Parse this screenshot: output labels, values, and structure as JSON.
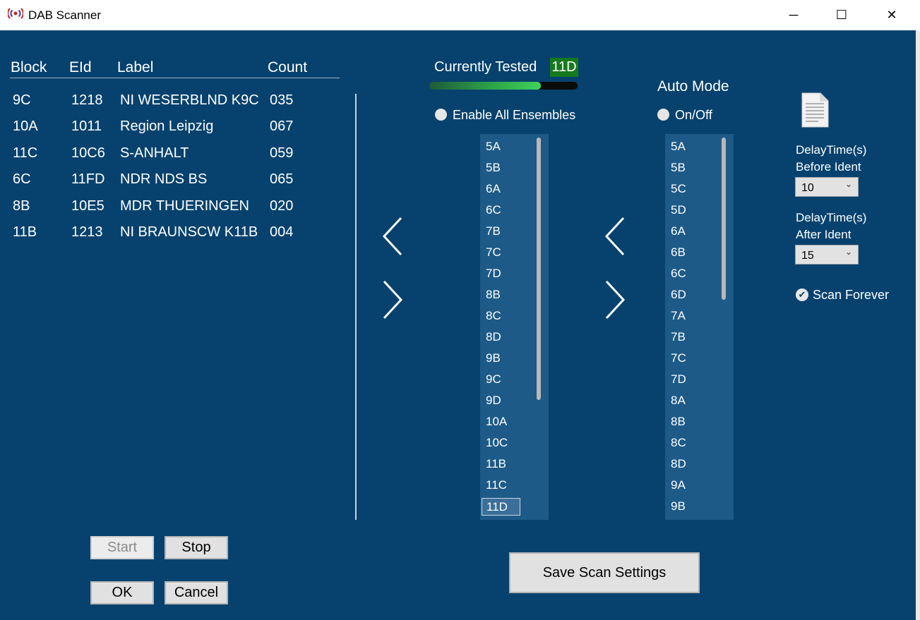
{
  "window": {
    "title": "DAB Scanner",
    "minimize": "─",
    "maximize": "☐",
    "close": "✕"
  },
  "table": {
    "headers": [
      "Block",
      "EId",
      "Label",
      "Count"
    ],
    "rows": [
      [
        "9C",
        "1218",
        "NI WESERBLND K9C",
        "035"
      ],
      [
        "10A",
        "1011",
        "Region Leipzig",
        "067"
      ],
      [
        "11C",
        "10C6",
        "S-ANHALT",
        "059"
      ],
      [
        "6C",
        "11FD",
        "NDR NDS BS",
        "065"
      ],
      [
        "8B",
        "10E5",
        "MDR THUERINGEN",
        "020"
      ],
      [
        "11B",
        "1213",
        "NI BRAUNSCW K11B",
        "004"
      ]
    ]
  },
  "scan": {
    "currently_tested_label": "Currently Tested",
    "currently_tested_value": "11D",
    "progress_fraction": 0.75,
    "progress_color": "#3fd25a"
  },
  "enable_all": {
    "label": "Enable All Ensembles"
  },
  "auto_mode": {
    "title": "Auto Mode",
    "toggle_label": "On/Off"
  },
  "manual_list": {
    "items": [
      "5A",
      "5B",
      "6A",
      "6C",
      "7B",
      "7C",
      "7D",
      "8B",
      "8C",
      "8D",
      "9B",
      "9C",
      "9D",
      "10A",
      "10C",
      "11B",
      "11C",
      "11D"
    ],
    "selected": "11D"
  },
  "auto_list": {
    "items": [
      "5A",
      "5B",
      "5C",
      "5D",
      "6A",
      "6B",
      "6C",
      "6D",
      "7A",
      "7B",
      "7C",
      "7D",
      "8A",
      "8B",
      "8C",
      "8D",
      "9A",
      "9B"
    ]
  },
  "delays": {
    "before_label_1": "DelayTime(s)",
    "before_label_2": "Before Ident",
    "before_value": "10",
    "after_label_1": "DelayTime(s)",
    "after_label_2": "After Ident",
    "after_value": "15"
  },
  "scan_forever": {
    "label": "Scan Forever",
    "checked": true
  },
  "buttons": {
    "start": "Start",
    "stop": "Stop",
    "ok": "OK",
    "cancel": "Cancel",
    "save": "Save Scan Settings"
  },
  "colors": {
    "background": "#07426e",
    "listbox": "#1d5a87",
    "current_badge": "#167a1d"
  },
  "icons": {
    "app": "radio-signal-icon",
    "left_arrow": "chevron-left-icon",
    "right_arrow": "chevron-right-icon",
    "document": "document-icon"
  }
}
